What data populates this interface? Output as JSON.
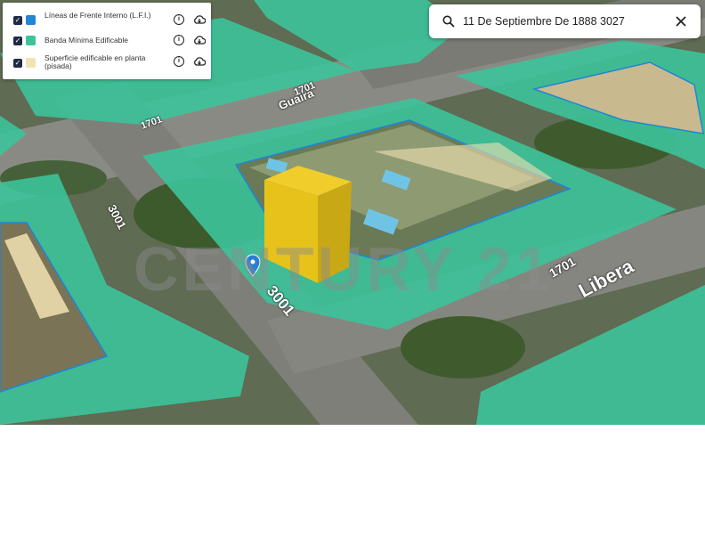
{
  "legend": {
    "items": [
      {
        "label": "Líneas de Frente Interno (L.F.I.)",
        "color": "#2186d4"
      },
      {
        "label": "Banda Mínima Edificable",
        "color": "#3cc39a"
      },
      {
        "label": "Superficie edificable en planta (pisada)",
        "color": "#f2e3b3"
      }
    ],
    "info_icon": "info-icon",
    "download_icon": "cloud-download-icon"
  },
  "search": {
    "value": "11 De Septiembre De 1888 3027",
    "search_icon": "search-icon",
    "clear_icon": "close-icon"
  },
  "map": {
    "watermark": "CENTURY 21",
    "street_labels": [
      {
        "text": "Guaira"
      },
      {
        "text": "1701"
      },
      {
        "text": "1701"
      },
      {
        "text": "3001"
      },
      {
        "text": "3001"
      },
      {
        "text": "1701"
      },
      {
        "text": "Libera"
      }
    ],
    "colors": {
      "band": "#3cc39a",
      "lfi": "#2186d4",
      "footprint": "#f2e3b3",
      "building": "#e6c21a",
      "pin": "#2a7fd4"
    }
  }
}
